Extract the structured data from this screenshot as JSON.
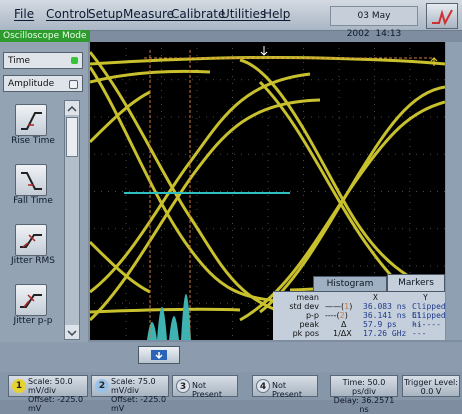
{
  "menu": {
    "items": [
      "File",
      "Control",
      "Setup",
      "Measure",
      "Calibrate",
      "Utilities",
      "Help"
    ],
    "date": "03 May 2002",
    "time": "14:13"
  },
  "mode": "Oscilloscope Mode",
  "left_panel": {
    "source": "Time",
    "category": "Amplitude",
    "tools": [
      "Rise Time",
      "Fall Time",
      "Jitter RMS",
      "Jitter p-p",
      ""
    ]
  },
  "results": {
    "tabs": [
      "Histogram",
      "Markers"
    ],
    "labels": [
      "mean",
      "std dev",
      "p-p",
      "peak",
      "pk pos"
    ],
    "header_x": "X",
    "header_y": "Y",
    "x_values": [
      "36.083 ns",
      "36.141 ns",
      "57.9 ps",
      "17.26 GHz"
    ],
    "x_symbols": [
      "",
      "",
      "Δ",
      "1/ΔX"
    ],
    "y_values": [
      "Clipped hi",
      "Clipped hi",
      "---------",
      ""
    ]
  },
  "status": {
    "ch1": {
      "num": "1",
      "line1": "Scale: 50.0 mV/div",
      "line2": "Offset: -225.0 mV"
    },
    "ch2": {
      "num": "2",
      "line1": "Scale: 75.0 mV/div",
      "line2": "Offset: -225.0 mV"
    },
    "ch3": {
      "num": "3",
      "text": "Not Present"
    },
    "ch4": {
      "num": "4",
      "text": "Not Present"
    },
    "timebase": {
      "line1": "Time: 50.0 ps/div",
      "line2": "Delay: 36.2571 ns"
    },
    "trigger": {
      "line1": "Trigger Level:",
      "line2": "0.0 V"
    }
  },
  "colors": {
    "trace": "#c8c02c",
    "histogram": "#3fb2b2",
    "marker": "#d07a3a",
    "mode_bar": "#2e9b2e",
    "ch1": "#e6d232",
    "ch2": "#9bc2e6"
  }
}
